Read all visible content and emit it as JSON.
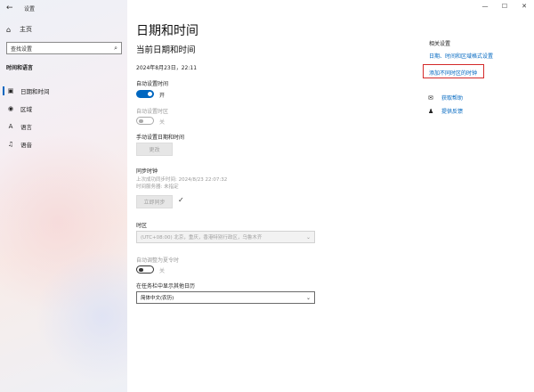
{
  "window": {
    "app_title": "设置",
    "controls": {
      "minimize": "—",
      "maximize": "☐",
      "close": "✕"
    }
  },
  "sidebar": {
    "home_label": "主页",
    "search_placeholder": "查找设置",
    "section_header": "时间和语言",
    "items": [
      {
        "label": "日期和时间",
        "icon": "calendar-clock-icon",
        "selected": true
      },
      {
        "label": "区域",
        "icon": "globe-icon",
        "selected": false
      },
      {
        "label": "语言",
        "icon": "language-icon",
        "selected": false
      },
      {
        "label": "语音",
        "icon": "microphone-icon",
        "selected": false
      }
    ]
  },
  "main": {
    "page_title": "日期和时间",
    "current_section_title": "当前日期和时间",
    "current_datetime": "2024年8月23日，22:11",
    "auto_time": {
      "label": "自动设置时间",
      "state_text": "开",
      "on": true
    },
    "auto_timezone": {
      "label": "自动设置时区",
      "state_text": "关",
      "on": false,
      "disabled": true
    },
    "manual": {
      "label": "手动设置日期和时间",
      "button": "更改"
    },
    "sync": {
      "label": "同步时钟",
      "last_sync": "上次成功同步时间: 2024/8/23 22:07:32",
      "server": "时间服务器: 未指定",
      "button": "立即同步"
    },
    "timezone": {
      "label": "时区",
      "value": "(UTC+08:00) 北京，重庆，香港特别行政区，乌鲁木齐"
    },
    "dst": {
      "label": "自动调整为夏令时",
      "state_text": "关",
      "on": false
    },
    "calendar": {
      "label": "在任务栏中显示其他日历",
      "value": "简体中文(农历)"
    }
  },
  "related": {
    "header": "相关设置",
    "links": [
      "日期、时间和区域格式设置",
      "添加不同时区的时钟"
    ],
    "highlighted_link": "添加不同时区的时钟",
    "help": {
      "label": "获取帮助",
      "icon": "chat-help-icon"
    },
    "feedback": {
      "label": "提供反馈",
      "icon": "feedback-person-icon"
    }
  },
  "colors": {
    "accent": "#0067c0",
    "highlight_box": "#d42a2a"
  }
}
